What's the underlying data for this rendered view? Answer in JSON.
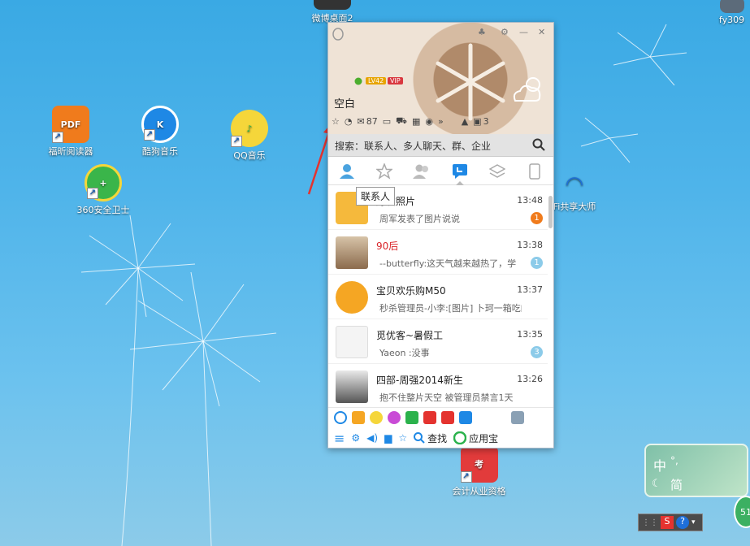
{
  "desktop": {
    "icons": [
      {
        "label": "福昕阅读器",
        "icon": "foxit-pdf-icon"
      },
      {
        "label": "酷狗音乐",
        "icon": "kugou-icon"
      },
      {
        "label": "QQ音乐",
        "icon": "qq-music-icon"
      },
      {
        "label": "360安全卫士",
        "icon": "360-safe-icon"
      },
      {
        "label": "会计从业资格",
        "icon": "kaoshi-icon"
      }
    ],
    "partial": [
      {
        "label": "微博桌面2"
      },
      {
        "label": "fy309"
      },
      {
        "label": "Fi共享大师"
      }
    ]
  },
  "qq": {
    "nickname": "空白",
    "level_badge": "LV42",
    "vip_badge": "VIP",
    "header_controls": [
      "skin-icon",
      "settings-icon",
      "minimize-icon",
      "close-icon"
    ],
    "mail_count": "87",
    "more_count": "3",
    "search_placeholder": "搜索：联系人、多人聊天、群、企业",
    "tooltip": "联系人",
    "tabs": [
      "contacts-icon",
      "favorites-icon",
      "groups-icon",
      "recent-chats-icon",
      "apps-icon",
      "phone-icon"
    ],
    "active_tab": "recent-chats-icon",
    "conversations": [
      {
        "name": "好友照片",
        "time": "13:48",
        "message": "周军发表了图片说说",
        "unread": "1",
        "badge_color": "#f07b1c"
      },
      {
        "name": "90后",
        "time": "13:38",
        "message": "--butterfly:这天气越来越热了，学",
        "unread": "1",
        "badge_color": "#8ccbe9",
        "name_color": "#d9262b"
      },
      {
        "name": "宝贝欢乐购M50",
        "time": "13:37",
        "message": "秒杀管理员-小李:[图片] 卜珂一箱吃的",
        "unread": "",
        "badge_color": ""
      },
      {
        "name": "觅优客~暑假工",
        "time": "13:35",
        "message": "Yaeon :没事",
        "unread": "3",
        "badge_color": "#8ccbe9"
      },
      {
        "name": "四部-周强2014新生",
        "time": "13:26",
        "message": "抱不住整片天空 被管理员禁言1天",
        "unread": "",
        "badge_color": ""
      }
    ],
    "bottom": {
      "find": "查找",
      "apps": "应用宝"
    }
  },
  "ime": {
    "lang": "中",
    "mode": "简"
  },
  "net_speed": "51"
}
